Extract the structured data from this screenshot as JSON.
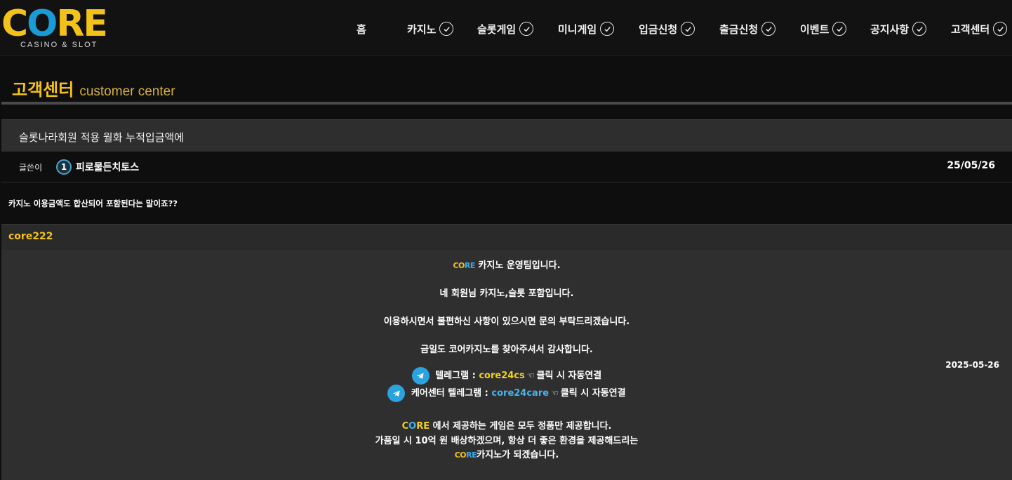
{
  "brand": {
    "logo_text": "CORE",
    "logo_subtitle": "CASINO & SLOT",
    "colors": {
      "gold": "#f3c21a",
      "blue": "#3fa9e8",
      "telegram": "#2aa3e0"
    }
  },
  "nav": {
    "home": "홈",
    "items": [
      {
        "label": "카지노",
        "icon": "check-circle-icon"
      },
      {
        "label": "슬롯게임",
        "icon": "check-circle-icon"
      },
      {
        "label": "미니게임",
        "icon": "check-circle-icon"
      },
      {
        "label": "입금신청",
        "icon": "check-circle-icon"
      },
      {
        "label": "출금신청",
        "icon": "check-circle-icon"
      },
      {
        "label": "이벤트",
        "icon": "check-circle-icon"
      },
      {
        "label": "공지사항",
        "icon": "check-circle-icon"
      },
      {
        "label": "고객센터",
        "icon": "check-circle-icon"
      }
    ]
  },
  "page": {
    "title_ko": "고객센터",
    "title_en": "customer center"
  },
  "post": {
    "subject": "슬롯나라회원 적용 월화 누적입금액에",
    "author_label": "글쓴이",
    "level": "1",
    "author": "피로물든치토스",
    "date": "25/05/26",
    "content": "카지노 이용금액도 합산되어 포함된다는 말이죠??"
  },
  "reply": {
    "author": "core222",
    "date": "2025-05-26",
    "mini_logo_a": "CO",
    "mini_logo_b": "RE",
    "line1": "카지노 운영팀입니다.",
    "line2": "네 회원님 카지노,슬롯 포함입니다.",
    "line3": "이용하시면서 불편하신 사항이 있으시면 문의 부탁드리겠습니다.",
    "line4": "금일도 코어카지노를 찾아주셔서 감사합니다.",
    "tg1_label": "텔레그램 : ",
    "tg1_id": "core24cs",
    "tg_hand": "☜",
    "tg_click": "클릭 시 자동연결",
    "tg2_label": "케어센터 텔레그램 : ",
    "tg2_id": "core24care",
    "core_word_c": "C",
    "core_word_o": "O",
    "core_word_re": "RE",
    "line5_rest": " 에서 제공하는 게임은 모두 정품만 제공합니다.",
    "line6": "가품일 시 10억 원 배상하겠으며, 항상 더 좋은 환경을 제공해드리는",
    "line7_rest": "카지노가 되겠습니다."
  }
}
